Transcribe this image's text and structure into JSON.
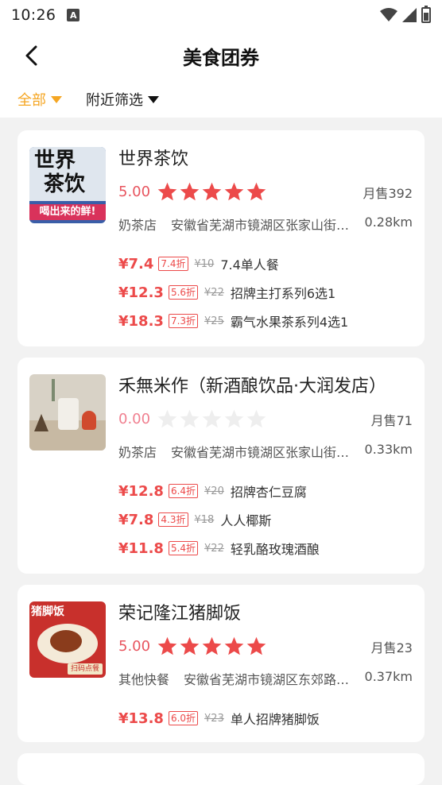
{
  "status": {
    "time": "10:26",
    "notif_glyph": "A"
  },
  "header": {
    "title": "美食团券"
  },
  "filters": [
    {
      "label": "全部"
    },
    {
      "label": "附近筛选"
    }
  ],
  "colors": {
    "accent": "#f5a623",
    "price_red": "#ec4a4a",
    "star_red": "#ec4a4a",
    "star_empty": "#eeeeee"
  },
  "shops": [
    {
      "name": "世界茶饮",
      "rating": "5.00",
      "stars": 5,
      "monthly": "月售392",
      "type": "奶茶店",
      "address": "安徽省芜湖市镜湖区张家山街道…",
      "distance": "0.28km",
      "thumb": {
        "line1": "世界",
        "line2": "茶饮",
        "banner": "喝出来的鲜!"
      },
      "deals": [
        {
          "price": "¥7.4",
          "discount": "7.4折",
          "orig": "¥10",
          "name": "7.4单人餐"
        },
        {
          "price": "¥12.3",
          "discount": "5.6折",
          "orig": "¥22",
          "name": "招牌主打系列6选1"
        },
        {
          "price": "¥18.3",
          "discount": "7.3折",
          "orig": "¥25",
          "name": "霸气水果茶系列4选1"
        }
      ]
    },
    {
      "name": "禾無米作（新酒酿饮品·大润发店）",
      "rating": "0.00",
      "stars": 0,
      "monthly": "月售71",
      "type": "奶茶店",
      "address": "安徽省芜湖市镜湖区张家山街道…",
      "distance": "0.33km",
      "deals": [
        {
          "price": "¥12.8",
          "discount": "6.4折",
          "orig": "¥20",
          "name": "招牌杏仁豆腐"
        },
        {
          "price": "¥7.8",
          "discount": "4.3折",
          "orig": "¥18",
          "name": "人人椰斯"
        },
        {
          "price": "¥11.8",
          "discount": "5.4折",
          "orig": "¥22",
          "name": "轻乳酪玫瑰酒酿"
        }
      ]
    },
    {
      "name": "荣记隆江猪脚饭",
      "rating": "5.00",
      "stars": 5,
      "monthly": "月售23",
      "type": "其他快餐",
      "address": "安徽省芜湖市镜湖区东郊路…",
      "distance": "0.37km",
      "thumb": {
        "label": "猪脚饭",
        "badge": "扫码点餐"
      },
      "deals": [
        {
          "price": "¥13.8",
          "discount": "6.0折",
          "orig": "¥23",
          "name": "单人招牌猪脚饭"
        }
      ]
    }
  ]
}
